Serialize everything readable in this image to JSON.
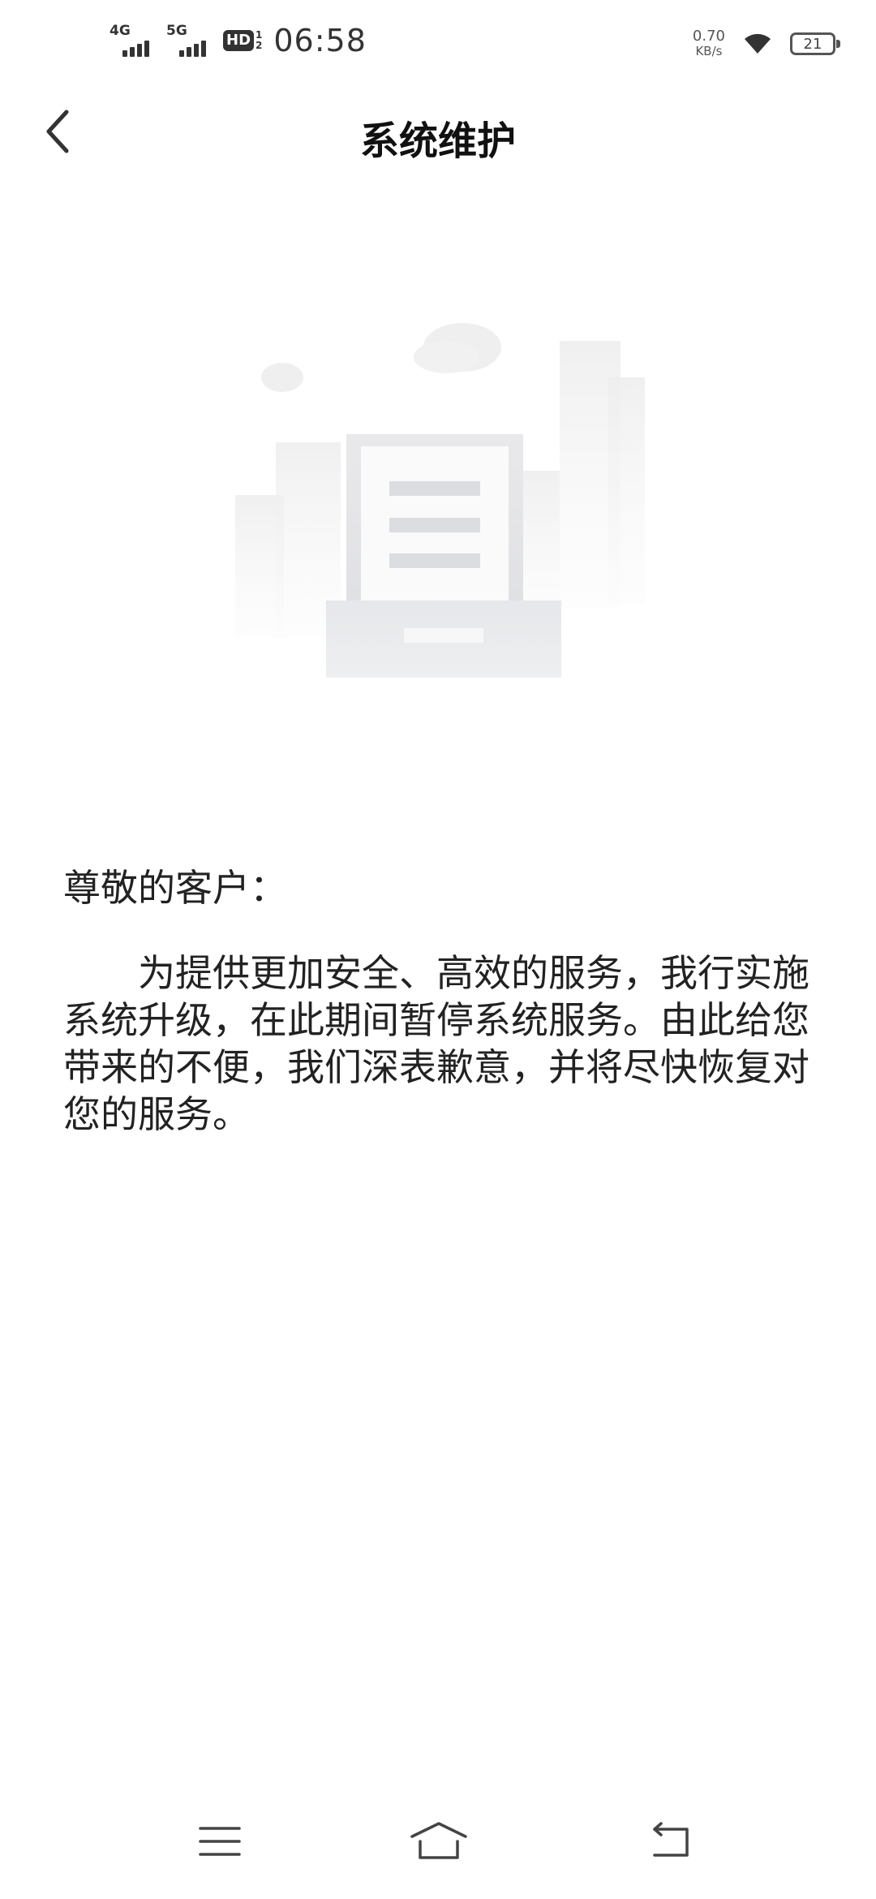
{
  "status_bar": {
    "network_1": "4G",
    "network_2": "5G",
    "hd_label": "HD",
    "hd_sub_1": "1",
    "hd_sub_2": "2",
    "time": "06:58",
    "speed_value": "0.70",
    "speed_unit": "KB/s",
    "battery_level": "21",
    "icons": [
      "signal-icon",
      "hd-icon",
      "wifi-icon",
      "battery-icon"
    ]
  },
  "header": {
    "title": "系统维护",
    "back_icon": "chevron-left-icon"
  },
  "illustration": {
    "icon": "maintenance-document-illustration"
  },
  "notice": {
    "greeting": "尊敬的客户：",
    "body": "为提供更加安全、高效的服务，我行实施系统升级，在此期间暂停系统服务。由此给您带来的不便，我们深表歉意，并将尽快恢复对您的服务。"
  },
  "nav_bar": {
    "icons": [
      "menu-icon",
      "home-icon",
      "back-icon"
    ]
  },
  "colors": {
    "background": "#ffffff",
    "text": "#222222",
    "illustration_gray": "#e8e9ec"
  }
}
